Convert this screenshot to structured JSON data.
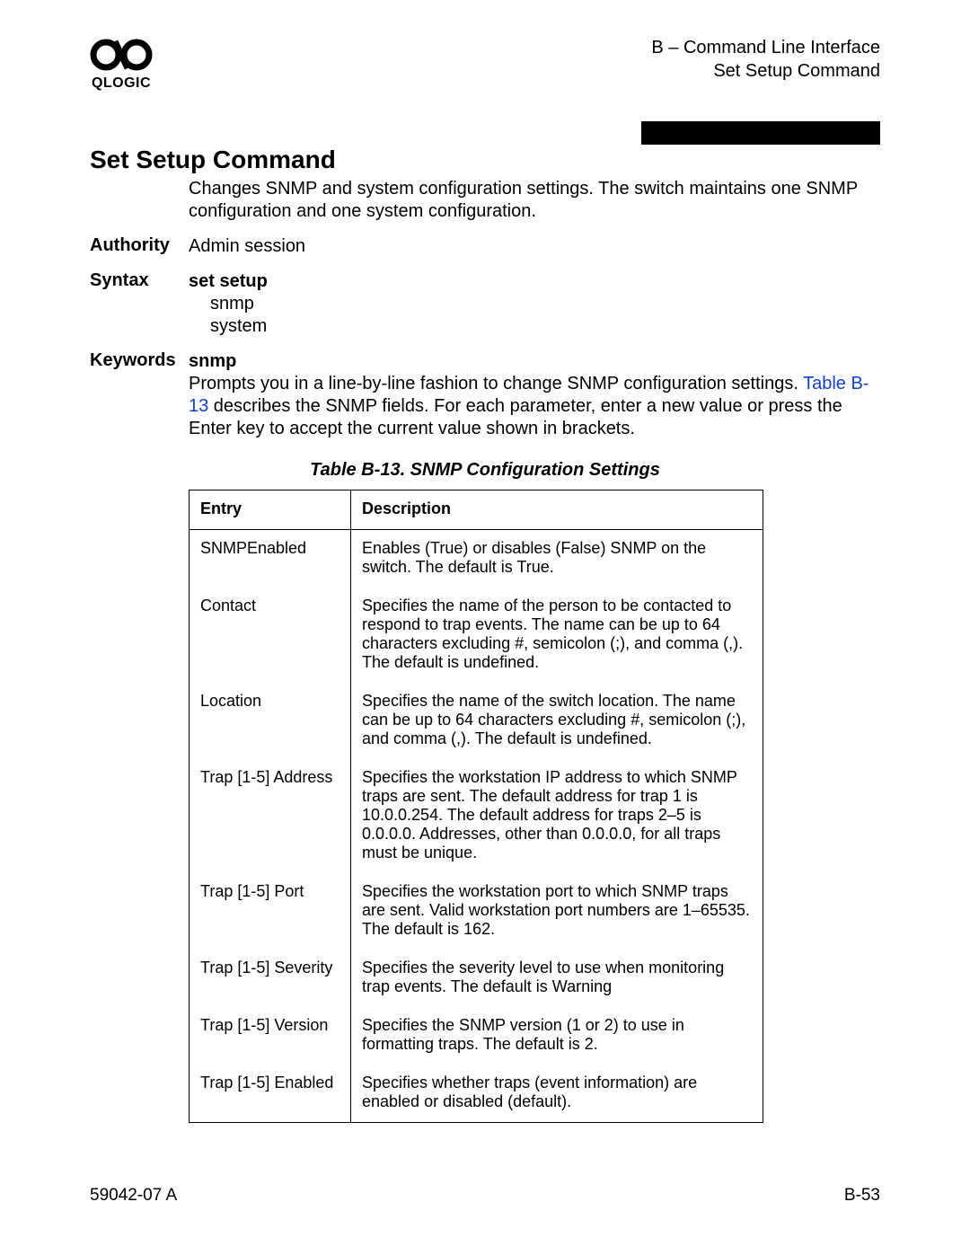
{
  "header": {
    "logo_text": "QLOGIC",
    "right_line1": "B – Command Line Interface",
    "right_line2": "Set Setup Command"
  },
  "section_title": "Set Setup Command",
  "intro": "Changes SNMP and system configuration settings. The switch maintains one SNMP configuration and one system configuration.",
  "authority": {
    "label": "Authority",
    "value": "Admin session"
  },
  "syntax": {
    "label": "Syntax",
    "command": "set setup",
    "args": [
      "snmp",
      "system"
    ]
  },
  "keywords": {
    "label": "Keywords",
    "name": "snmp",
    "desc_pre": "Prompts you in a line-by-line fashion to change SNMP configuration settings. ",
    "link": "Table B-13",
    "desc_post": " describes the SNMP fields. For each parameter, enter a new value or press the Enter key to accept the current value shown in brackets."
  },
  "table": {
    "caption": "Table B-13. SNMP Configuration Settings",
    "col1": "Entry",
    "col2": "Description",
    "rows": [
      {
        "entry": "SNMPEnabled",
        "desc": "Enables (True) or disables (False) SNMP on the switch. The default is True."
      },
      {
        "entry": "Contact",
        "desc": "Specifies the name of the person to be contacted to respond to trap events. The name can be up to 64 characters excluding #, semicolon (;), and comma (,). The default is undefined."
      },
      {
        "entry": "Location",
        "desc": "Specifies the name of the switch location. The name can be up to 64 characters excluding #, semicolon (;), and comma (,). The default is undefined."
      },
      {
        "entry": "Trap [1-5] Address",
        "desc": "Specifies the workstation IP address to which SNMP traps are sent. The default address for trap 1 is 10.0.0.254. The default address for traps 2–5 is 0.0.0.0. Addresses, other than 0.0.0.0, for all traps must be unique."
      },
      {
        "entry": "Trap [1-5] Port",
        "desc": "Specifies the workstation port to which SNMP traps are sent. Valid workstation port numbers are 1–65535. The default is 162."
      },
      {
        "entry": "Trap [1-5] Severity",
        "desc": "Specifies the severity level to use when monitoring trap events. The default is Warning"
      },
      {
        "entry": "Trap [1-5] Version",
        "desc": "Specifies the SNMP version (1 or 2) to use in formatting traps. The default is 2."
      },
      {
        "entry": "Trap [1-5] Enabled",
        "desc": "Specifies whether traps (event information) are enabled or disabled (default)."
      }
    ]
  },
  "footer": {
    "left": "59042-07 A",
    "right": "B-53"
  }
}
